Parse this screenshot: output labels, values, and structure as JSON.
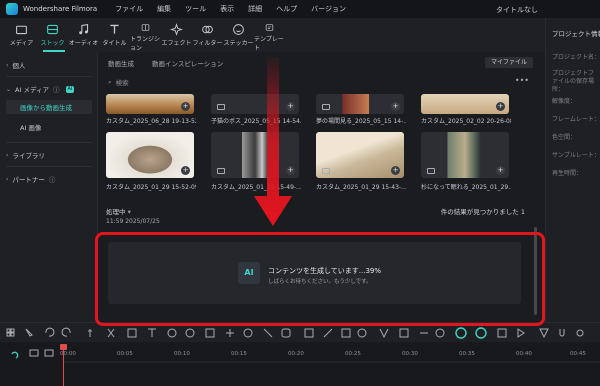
{
  "menubar": {
    "app_name": "Wondershare Filmora",
    "items": [
      "ファイル",
      "編集",
      "ツール",
      "表示",
      "詳細",
      "ヘルプ",
      "バージョン"
    ],
    "file_title": "タイトルなし"
  },
  "toolbar": {
    "items": [
      "メディア",
      "ストック",
      "オーディオ",
      "タイトル",
      "トランジション",
      "エフェクト",
      "フィルター",
      "ステッカー",
      "テンプレート"
    ]
  },
  "left_panel": {
    "personal": "個人",
    "ai_media": "AI メディア",
    "ai_badge": "AI",
    "sub_items": [
      "画像から動画生成",
      "AI 画像"
    ],
    "library": "ライブラリ",
    "partner": "パートナー"
  },
  "main": {
    "tabs": [
      "動画生成",
      "動画インスピレーション"
    ],
    "my_file": "マイファイル",
    "search_placeholder": "検索",
    "cards": [
      {
        "caption": "カスタム_2025_06_28 19-13-52..."
      },
      {
        "caption": "子猫のボス_2025_05_15 14-54..."
      },
      {
        "caption": "夢の場間見る_2025_05_15 14-..."
      },
      {
        "caption": "カスタム_2025_02_02 20-26-08..."
      },
      {
        "caption": "カスタム_2025_01_29 15-52-09..."
      },
      {
        "caption": "カスタム_2025_01_29 15-49-..."
      },
      {
        "caption": "カスタム_2025_01_29 15-43-..."
      },
      {
        "caption": "杉になって眠れる_2025_01_29..."
      }
    ],
    "processing_label": "処理中",
    "processing_time": "11:59 2025/07/25",
    "results_text": "件の結果が見つかりました 1",
    "gen_title": "コンテンツを生成しています...39%",
    "gen_sub": "しばらくお待ちください。もう少しです。",
    "ai_icon_label": "AI"
  },
  "right_panel": {
    "title": "プロジェクト情報",
    "items": [
      "プロジェクト名：",
      "プロジェクトファイルの保存場所：",
      "解像度：",
      "フレームレート：",
      "色空間：",
      "サンプルレート：",
      "再生時間："
    ]
  },
  "timeline": {
    "ticks": [
      "00:00",
      "00:05",
      "00:10",
      "00:15",
      "00:20",
      "00:25",
      "00:30",
      "00:35",
      "00:40",
      "00:45"
    ]
  },
  "colors": {
    "accent": "#3fd5c7",
    "highlight_red": "#e5151f"
  }
}
